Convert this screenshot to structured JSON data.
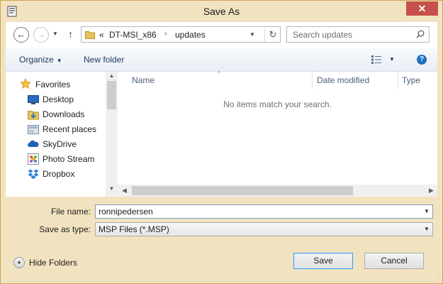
{
  "window": {
    "title": "Save As",
    "close_glyph": "✕"
  },
  "nav": {
    "back_glyph": "←",
    "forward_glyph": "→",
    "history_glyph": "▼",
    "up_glyph": "↑"
  },
  "address": {
    "overflow": "«",
    "segments": [
      "DT-MSI_x86",
      "updates"
    ],
    "separator": "›",
    "dropdown_glyph": "▼",
    "refresh_glyph": "↻"
  },
  "search": {
    "placeholder": "Search updates"
  },
  "toolbar": {
    "organize": "Organize",
    "organize_arrow": "▼",
    "new_folder": "New folder",
    "view_arrow": "▼",
    "help_glyph": "?"
  },
  "navpane": {
    "items": [
      {
        "label": "Favorites",
        "icon": "star-icon"
      },
      {
        "label": "Desktop",
        "icon": "desktop-icon"
      },
      {
        "label": "Downloads",
        "icon": "downloads-icon"
      },
      {
        "label": "Recent places",
        "icon": "recent-places-icon"
      },
      {
        "label": "SkyDrive",
        "icon": "skydrive-icon"
      },
      {
        "label": "Photo Stream",
        "icon": "photo-stream-icon"
      },
      {
        "label": "Dropbox",
        "icon": "dropbox-icon"
      }
    ]
  },
  "filelist": {
    "columns": [
      "Name",
      "Date modified",
      "Type"
    ],
    "sort_glyph": "^",
    "empty_message": "No items match your search."
  },
  "scroll": {
    "up": "▲",
    "down": "▼",
    "left": "◀",
    "right": "▶"
  },
  "form": {
    "file_name_label": "File name:",
    "file_name_value": "ronnipedersen",
    "save_type_label": "Save as type:",
    "save_type_value": "MSP Files (*.MSP)",
    "drop_glyph": "▼"
  },
  "footer": {
    "hide_folders": "Hide Folders",
    "hide_glyph": "▲",
    "save": "Save",
    "cancel": "Cancel"
  },
  "colors": {
    "accent": "#3399ff",
    "window_frame": "#f2e3c0",
    "close": "#c7504a",
    "toolbar_text": "#1e395b"
  }
}
